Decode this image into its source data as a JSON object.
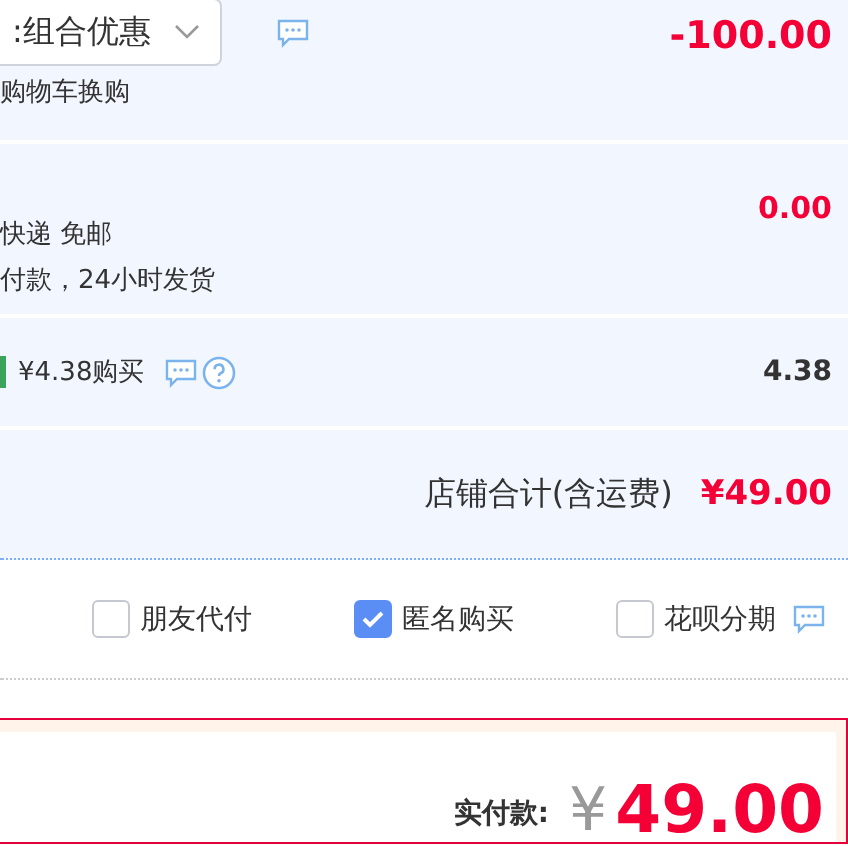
{
  "promotion": {
    "select_value": ":组合优惠",
    "note": "购物车换购",
    "amount": "-100.00"
  },
  "shipping": {
    "method": "快递 免邮",
    "note": "付款，24小时发货",
    "amount": "0.00"
  },
  "insurance": {
    "label": "¥4.38购买",
    "amount": "4.38"
  },
  "shop_total": {
    "label": "店铺合计(含运费)",
    "amount": "¥49.00"
  },
  "options": [
    {
      "label": "朋友代付",
      "checked": false
    },
    {
      "label": "匿名购买",
      "checked": true
    },
    {
      "label": "花呗分期",
      "checked": false
    }
  ],
  "payment": {
    "label": "实付款:",
    "currency": "¥",
    "amount": "49.00"
  }
}
